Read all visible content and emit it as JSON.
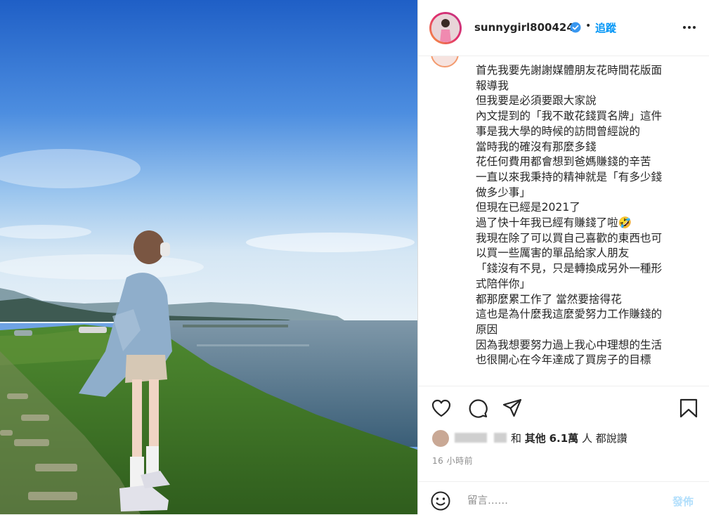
{
  "post": {
    "username": "sunnygirl800424",
    "follow_label": "追蹤",
    "separator": "•",
    "caption_lines": [
      "首先我要先謝謝媒體朋友花時間花版面",
      "報導我",
      "但我要是必須要跟大家說",
      "內文提到的「我不敢花錢買名牌」這件",
      "事是我大學的時候的訪問曾經說的",
      "當時我的確沒有那麼多錢",
      "花任何費用都會想到爸媽賺錢的辛苦",
      "一直以來我秉持的精神就是「有多少錢",
      "做多少事」",
      "但現在已經是2021了",
      "過了快十年我已經有賺錢了啦🤣",
      "我現在除了可以買自己喜歡的東西也可",
      "以買一些厲害的單品給家人朋友",
      "「錢沒有不見，只是轉換成另外一種形",
      "式陪伴你」",
      "都那麼累工作了 當然要捨得花",
      "這也是為什麼我這麼愛努力工作賺錢的",
      "原因",
      "因為我想要努力過上我心中理想的生活",
      "也很開心在今年達成了買房子的目標"
    ],
    "likes": {
      "connector": "和",
      "others_label": "其他",
      "count": "6.1萬",
      "suffix": "人 都說讚"
    },
    "timestamp": "16 小時前",
    "comment": {
      "placeholder": "留言……",
      "post_label": "發佈"
    }
  },
  "icons": {
    "verified": "verified-badge-icon",
    "more": "more-options-icon",
    "like": "heart-icon",
    "comment": "comment-bubble-icon",
    "share": "paper-plane-icon",
    "save": "bookmark-icon",
    "emoji": "smiley-icon"
  },
  "colors": {
    "accent": "#0095f6",
    "post_disabled": "#b2dffc",
    "muted": "#8e8e8e"
  }
}
